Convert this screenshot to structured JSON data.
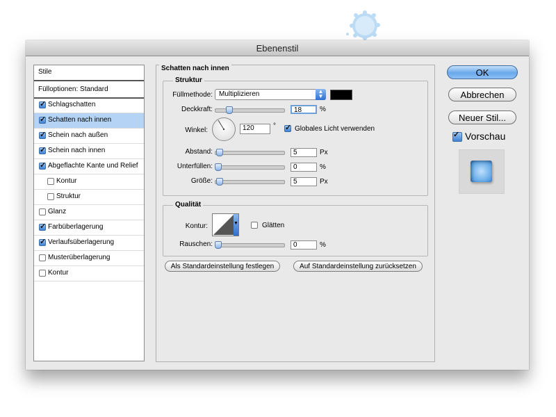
{
  "dialog": {
    "title": "Ebenenstil"
  },
  "sidebar": {
    "items": [
      {
        "label": "Stile",
        "type": "header",
        "checkbox": null,
        "indent": false,
        "selected": false
      },
      {
        "label": "Fülloptionen: Standard",
        "type": "header",
        "checkbox": null,
        "indent": false,
        "selected": false
      },
      {
        "label": "Schlagschatten",
        "type": "item",
        "checkbox": true,
        "indent": false,
        "selected": false
      },
      {
        "label": "Schatten nach innen",
        "type": "item",
        "checkbox": true,
        "indent": false,
        "selected": true
      },
      {
        "label": "Schein nach außen",
        "type": "item",
        "checkbox": true,
        "indent": false,
        "selected": false
      },
      {
        "label": "Schein nach innen",
        "type": "item",
        "checkbox": true,
        "indent": false,
        "selected": false
      },
      {
        "label": "Abgeflachte Kante und Relief",
        "type": "item",
        "checkbox": true,
        "indent": false,
        "selected": false
      },
      {
        "label": "Kontur",
        "type": "item",
        "checkbox": false,
        "indent": true,
        "selected": false
      },
      {
        "label": "Struktur",
        "type": "item",
        "checkbox": false,
        "indent": true,
        "selected": false
      },
      {
        "label": "Glanz",
        "type": "item",
        "checkbox": false,
        "indent": false,
        "selected": false
      },
      {
        "label": "Farbüberlagerung",
        "type": "item",
        "checkbox": true,
        "indent": false,
        "selected": false
      },
      {
        "label": "Verlaufsüberlagerung",
        "type": "item",
        "checkbox": true,
        "indent": false,
        "selected": false
      },
      {
        "label": "Musterüberlagerung",
        "type": "item",
        "checkbox": false,
        "indent": false,
        "selected": false
      },
      {
        "label": "Kontur",
        "type": "item",
        "checkbox": false,
        "indent": false,
        "selected": false
      }
    ]
  },
  "main": {
    "section_title": "Schatten nach innen",
    "structure": {
      "title": "Struktur",
      "blend_mode_label": "Füllmethode:",
      "blend_mode_value": "Multiplizieren",
      "swatch_color": "#000000",
      "opacity_label": "Deckkraft:",
      "opacity_value": "18",
      "opacity_unit": "%",
      "opacity_level": 0.18,
      "angle_label": "Winkel:",
      "angle_value": "120",
      "angle_unit": "°",
      "global_light_label": "Globales Licht verwenden",
      "global_light_checked": true,
      "distance_label": "Abstand:",
      "distance_value": "5",
      "distance_unit": "Px",
      "distance_level": 0.02,
      "choke_label": "Unterfüllen:",
      "choke_value": "0",
      "choke_unit": "%",
      "choke_level": 0.0,
      "size_label": "Größe:",
      "size_value": "5",
      "size_unit": "Px",
      "size_level": 0.02
    },
    "quality": {
      "title": "Qualität",
      "contour_label": "Kontur:",
      "antialias_label": "Glätten",
      "antialias_checked": false,
      "noise_label": "Rauschen:",
      "noise_value": "0",
      "noise_unit": "%",
      "noise_level": 0.0
    },
    "make_default_label": "Als Standardeinstellung festlegen",
    "reset_default_label": "Auf Standardeinstellung zurücksetzen"
  },
  "actions": {
    "ok_label": "OK",
    "cancel_label": "Abbrechen",
    "new_style_label": "Neuer Stil...",
    "preview_label": "Vorschau",
    "preview_checked": true
  }
}
